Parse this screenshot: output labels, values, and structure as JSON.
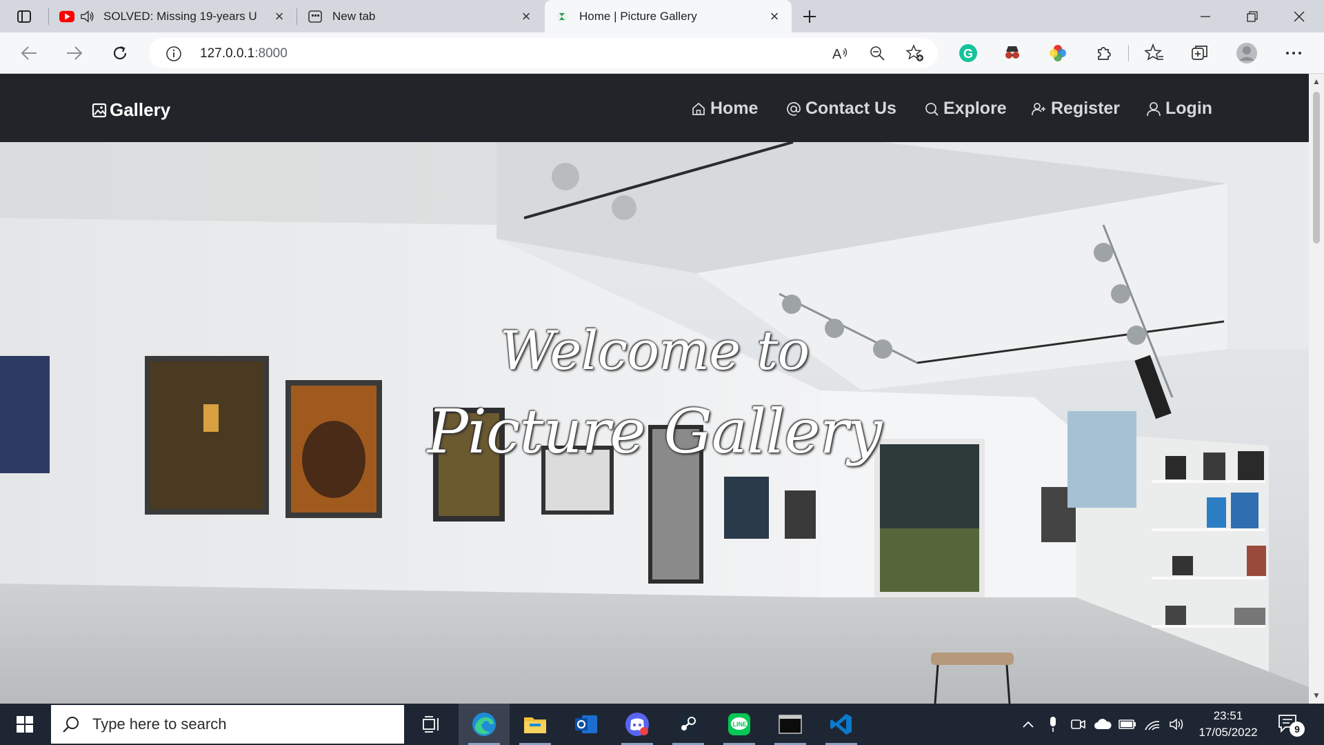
{
  "browser": {
    "tabs": [
      {
        "title": "SOLVED: Missing 19-years U",
        "favicon": "youtube-icon",
        "audio": true
      },
      {
        "title": "New tab",
        "favicon": "new-tab-icon"
      },
      {
        "title": "Home | Picture Gallery",
        "favicon": "django-site-icon",
        "active": true
      }
    ],
    "address": {
      "host": "127.0.0.1",
      "port": ":8000"
    }
  },
  "site": {
    "brand": "Gallery",
    "nav": [
      {
        "label": "Home",
        "icon": "home-icon"
      },
      {
        "label": "Contact Us",
        "icon": "at-icon"
      },
      {
        "label": "Explore",
        "icon": "search-icon"
      },
      {
        "label": "Register",
        "icon": "user-plus-icon"
      },
      {
        "label": "Login",
        "icon": "user-icon"
      }
    ],
    "hero": {
      "line1": "Welcome to",
      "line2": "Picture Gallery"
    }
  },
  "taskbar": {
    "search_placeholder": "Type here to search",
    "time": "23:51",
    "date": "17/05/2022",
    "notification_count": "9"
  },
  "colors": {
    "navbar": "#212529",
    "taskbar": "#1f2633",
    "tabbar": "#d4d8de"
  }
}
